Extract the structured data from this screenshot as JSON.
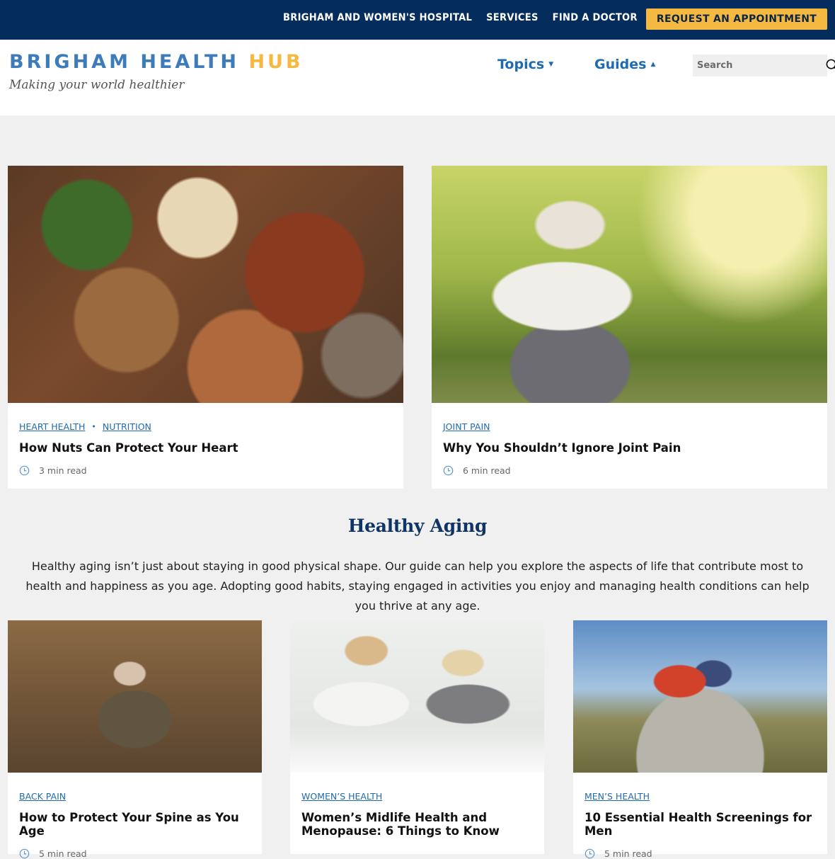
{
  "topbar": {
    "links": [
      "BRIGHAM AND WOMEN'S HOSPITAL",
      "SERVICES",
      "FIND A DOCTOR"
    ],
    "cta": "REQUEST AN APPOINTMENT"
  },
  "header": {
    "logo_main": "BRIGHAM HEALTH ",
    "logo_accent": "HUB",
    "tagline": "Making your world healthier",
    "nav": [
      {
        "label": "Topics",
        "caret": "down"
      },
      {
        "label": "Guides",
        "caret": "up"
      }
    ],
    "search": {
      "placeholder": "Search",
      "value": ""
    }
  },
  "featured": [
    {
      "tags": [
        "HEART HEALTH",
        "NUTRITION"
      ],
      "title": "How Nuts Can Protect Your Heart",
      "read_time": "3 min read",
      "image": "assorted nuts"
    },
    {
      "tags": [
        "JOINT PAIN"
      ],
      "title": "Why You Shouldn’t Ignore Joint Pain",
      "read_time": "6 min read",
      "image": "woman resting during run in park"
    }
  ],
  "section": {
    "title": "Healthy Aging",
    "description": "Healthy aging isn’t just about staying in good physical shape. Our guide can help you explore the aspects of life that contribute most to health and happiness as you age. Adopting good habits, staying engaged in activities you enjoy and managing health conditions can help you thrive at any age."
  },
  "guide_cards": [
    {
      "tags": [
        "BACK PAIN"
      ],
      "title": "How to Protect Your Spine as You Age",
      "read_time": "5 min read",
      "image": "older man in workshop holding back"
    },
    {
      "tags": [
        "WOMEN’S HEALTH"
      ],
      "title": "Women’s Midlife Health and Menopause: 6 Things to Know",
      "read_time": "",
      "image": "doctor consulting with woman"
    },
    {
      "tags": [
        "MEN’S HEALTH"
      ],
      "title": "10 Essential Health Screenings for Men",
      "read_time": "5 min read",
      "image": "hiker sitting on rock with tablet"
    }
  ],
  "colors": {
    "navy": "#042c5c",
    "accent_yellow": "#f5b942",
    "link_blue": "#1e6bb0",
    "logo_blue": "#3e7cb9",
    "section_title": "#0e3566",
    "page_bg": "#f0f0f0"
  },
  "icons": {
    "search": "search-icon",
    "clock": "clock-icon",
    "caret_down": "caret-down-icon",
    "caret_up": "caret-up-icon"
  }
}
